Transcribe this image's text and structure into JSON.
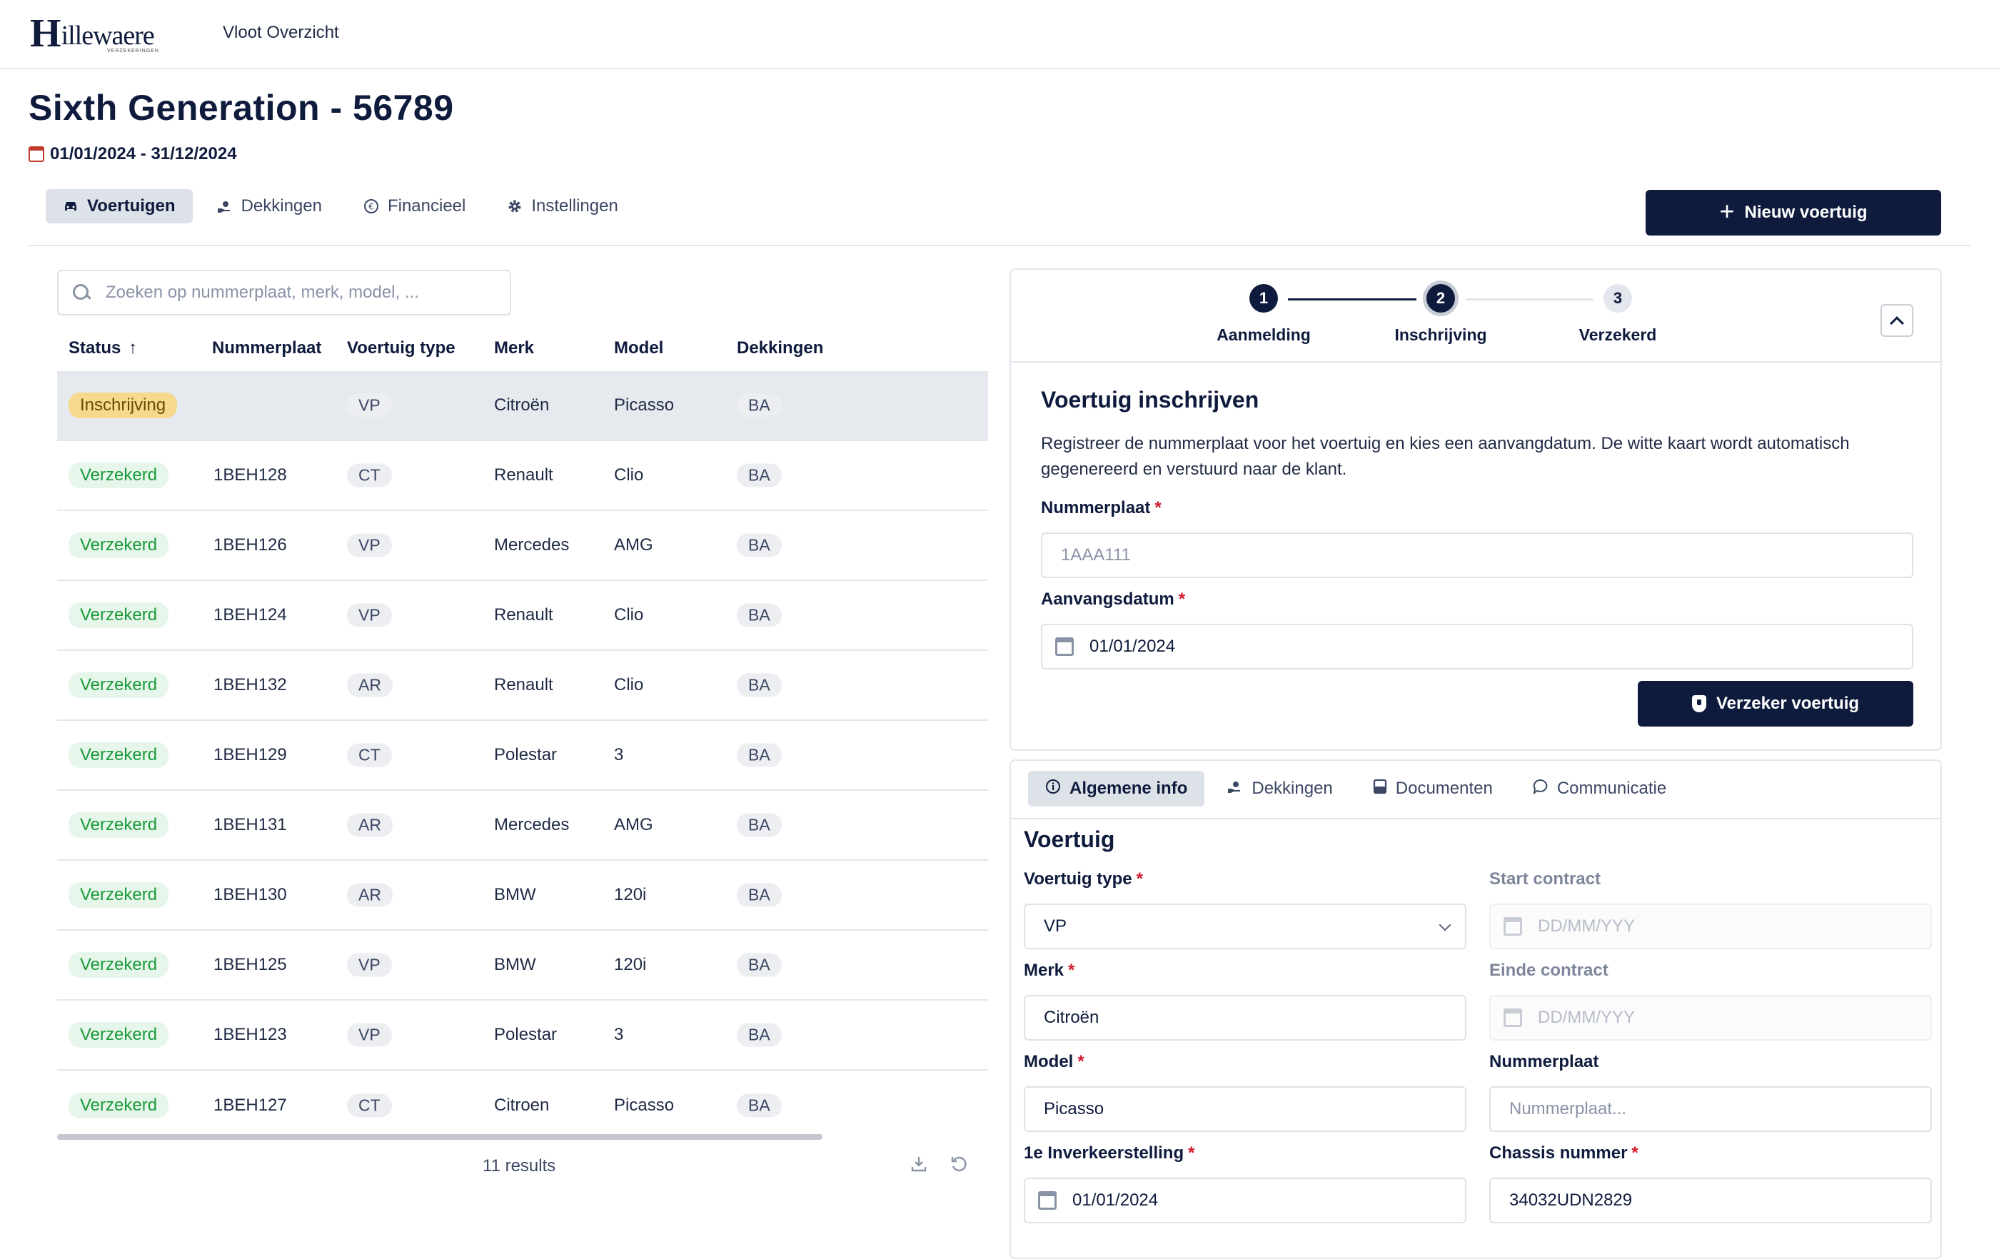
{
  "brand": {
    "logo_initial": "H",
    "logo_rest": "illewaere",
    "logo_sub": "VERZEKERINGEN"
  },
  "nav": {
    "link": "Vloot Overzicht"
  },
  "page": {
    "title": "Sixth Generation - 56789",
    "period": "01/01/2024 - 31/12/2024"
  },
  "tabs": [
    {
      "label": "Voertuigen",
      "icon": "car-icon"
    },
    {
      "label": "Dekkingen",
      "icon": "hand-coverage-icon"
    },
    {
      "label": "Financieel",
      "icon": "euro-icon"
    },
    {
      "label": "Instellingen",
      "icon": "gear-icon"
    }
  ],
  "actions": {
    "new_vehicle": "Nieuw voertuig"
  },
  "search": {
    "placeholder": "Zoeken op nummerplaat, merk, model, ..."
  },
  "table": {
    "headers": {
      "status": "Status",
      "sort_indicator": "↑",
      "plate": "Nummerplaat",
      "type": "Voertuig type",
      "merk": "Merk",
      "model": "Model",
      "dekkingen": "Dekkingen"
    },
    "rows": [
      {
        "status": "Inschrijving",
        "plate": "",
        "type": "VP",
        "merk": "Citroën",
        "model": "Picasso",
        "dek": "BA"
      },
      {
        "status": "Verzekerd",
        "plate": "1BEH128",
        "type": "CT",
        "merk": "Renault",
        "model": "Clio",
        "dek": "BA"
      },
      {
        "status": "Verzekerd",
        "plate": "1BEH126",
        "type": "VP",
        "merk": "Mercedes",
        "model": "AMG",
        "dek": "BA"
      },
      {
        "status": "Verzekerd",
        "plate": "1BEH124",
        "type": "VP",
        "merk": "Renault",
        "model": "Clio",
        "dek": "BA"
      },
      {
        "status": "Verzekerd",
        "plate": "1BEH132",
        "type": "AR",
        "merk": "Renault",
        "model": "Clio",
        "dek": "BA"
      },
      {
        "status": "Verzekerd",
        "plate": "1BEH129",
        "type": "CT",
        "merk": "Polestar",
        "model": "3",
        "dek": "BA"
      },
      {
        "status": "Verzekerd",
        "plate": "1BEH131",
        "type": "AR",
        "merk": "Mercedes",
        "model": "AMG",
        "dek": "BA"
      },
      {
        "status": "Verzekerd",
        "plate": "1BEH130",
        "type": "AR",
        "merk": "BMW",
        "model": "120i",
        "dek": "BA"
      },
      {
        "status": "Verzekerd",
        "plate": "1BEH125",
        "type": "VP",
        "merk": "BMW",
        "model": "120i",
        "dek": "BA"
      },
      {
        "status": "Verzekerd",
        "plate": "1BEH123",
        "type": "VP",
        "merk": "Polestar",
        "model": "3",
        "dek": "BA"
      },
      {
        "status": "Verzekerd",
        "plate": "1BEH127",
        "type": "CT",
        "merk": "Citroen",
        "model": "Picasso",
        "dek": "BA"
      }
    ],
    "results": "11 results"
  },
  "stepper": {
    "steps": [
      {
        "num": "1",
        "label": "Aanmelding"
      },
      {
        "num": "2",
        "label": "Inschrijving"
      },
      {
        "num": "3",
        "label": "Verzekerd"
      }
    ]
  },
  "register": {
    "title": "Voertuig inschrijven",
    "description": "Registreer de nummerplaat voor het voertuig en kies een aanvangdatum. De witte kaart wordt automatisch gegenereerd en verstuurd naar de klant.",
    "plate_label": "Nummerplaat",
    "plate_placeholder": "1AAA111",
    "start_label": "Aanvangsdatum",
    "start_value": "01/01/2024",
    "submit": "Verzeker voertuig"
  },
  "detail_tabs": [
    {
      "label": "Algemene info",
      "icon": "info-icon"
    },
    {
      "label": "Dekkingen",
      "icon": "hand-coverage-icon"
    },
    {
      "label": "Documenten",
      "icon": "document-icon"
    },
    {
      "label": "Communicatie",
      "icon": "chat-icon"
    }
  ],
  "vehicle": {
    "title": "Voertuig",
    "type_label": "Voertuig type",
    "type_value": "VP",
    "start_contract_label": "Start contract",
    "start_contract_placeholder": "DD/MM/YYY",
    "merk_label": "Merk",
    "merk_value": "Citroën",
    "end_contract_label": "Einde contract",
    "end_contract_placeholder": "DD/MM/YYY",
    "model_label": "Model",
    "model_value": "Picasso",
    "plate_label": "Nummerplaat",
    "plate_placeholder": "Nummerplaat...",
    "first_reg_label": "1e Inverkeerstelling",
    "first_reg_value": "01/01/2024",
    "chassis_label": "Chassis nummer",
    "chassis_value": "34032UDN2829",
    "required_mark": "*"
  }
}
